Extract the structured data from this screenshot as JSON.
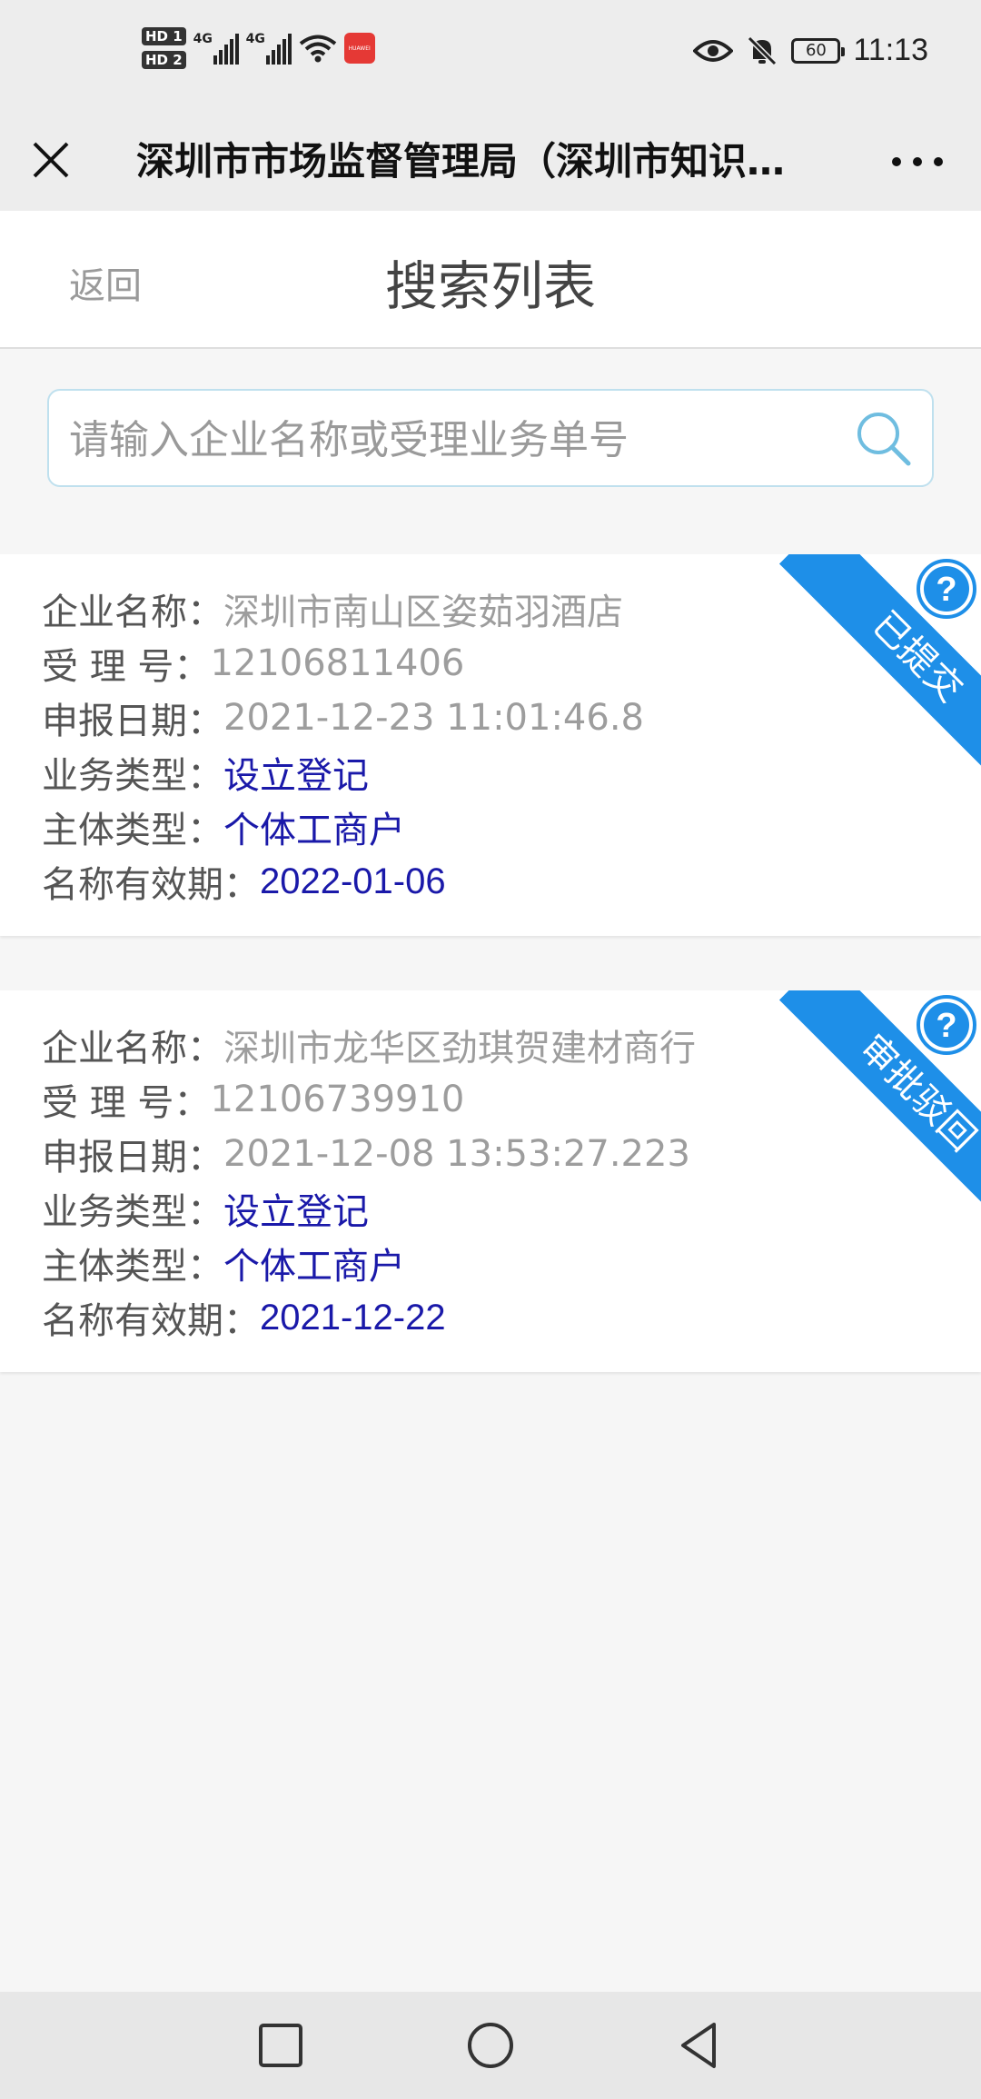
{
  "status_bar": {
    "sim1": "HD 1",
    "sim2": "HD 2",
    "network1": "4G",
    "network2": "4G",
    "app_icon_label": "HUAWEI",
    "battery": "60",
    "time": "11:13"
  },
  "wechat": {
    "title": "深圳市市场监督管理局（深圳市知识产权局）"
  },
  "header": {
    "back_label": "返回",
    "title": "搜索列表"
  },
  "search": {
    "placeholder": "请输入企业名称或受理业务单号"
  },
  "labels": {
    "company": "企业名称：",
    "accept_no": "受 理 号：",
    "report_date": "申报日期：",
    "business_type": "业务类型：",
    "entity_type": "主体类型：",
    "name_valid": "名称有效期："
  },
  "colors": {
    "ribbon": "#1e8fe8",
    "link_blue": "#1a19a9",
    "gray_value": "#9d9d9d"
  },
  "records": [
    {
      "status": "已提交",
      "company": "深圳市南山区姿茹羽酒店",
      "accept_no": "12106811406",
      "report_date": "2021-12-23 11:01:46.8",
      "business_type": "设立登记",
      "entity_type": "个体工商户",
      "name_valid": "2022-01-06"
    },
    {
      "status": "审批驳回",
      "company": "深圳市龙华区劲琪贺建材商行",
      "accept_no": "12106739910",
      "report_date": "2021-12-08 13:53:27.223",
      "business_type": "设立登记",
      "entity_type": "个体工商户",
      "name_valid": "2021-12-22"
    }
  ]
}
